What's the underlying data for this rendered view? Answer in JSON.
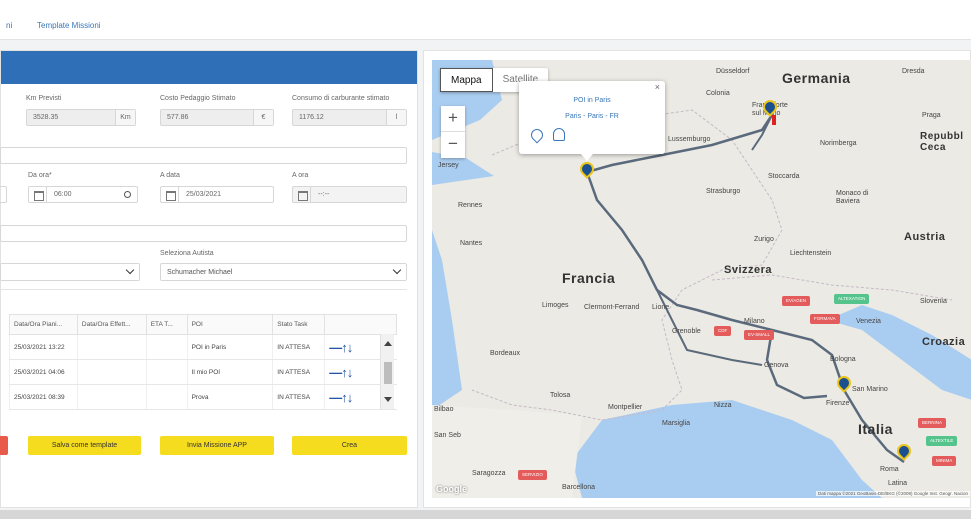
{
  "breadcrumb": {
    "prev": "ni",
    "current": "Template Missioni"
  },
  "form": {
    "km": {
      "label": "Km Previsti",
      "value": "3528.35",
      "unit": "Km"
    },
    "toll": {
      "label": "Costo Pedaggio Stimato",
      "value": "577.86",
      "unit": "€"
    },
    "fuel": {
      "label": "Consumo di carburante stimato",
      "value": "1176.12",
      "unit": "l"
    },
    "from_time": {
      "label": "Da ora*",
      "value": "06:00"
    },
    "to_date": {
      "label": "A data",
      "value": "25/03/2021"
    },
    "to_time": {
      "label": "A ora",
      "placeholder": "--:--"
    },
    "driver": {
      "label": "Seleziona Autista",
      "value": "Schumacher Michael"
    }
  },
  "table": {
    "headers": [
      "Data/Ora Piani...",
      "Data/Ora Effett...",
      "ETA T...",
      "POI",
      "Stato Task",
      ""
    ],
    "rows": [
      {
        "planned": "25/03/2021 13:22",
        "actual": "",
        "eta": "",
        "poi": "POI in Paris",
        "status": "IN ATTESA",
        "move": "—↑↓"
      },
      {
        "planned": "25/03/2021 04:06",
        "actual": "",
        "eta": "",
        "poi": "Il mio POI",
        "status": "IN ATTESA",
        "move": "—↑↓"
      },
      {
        "planned": "25/03/2021 08:39",
        "actual": "",
        "eta": "",
        "poi": "Prova",
        "status": "IN ATTESA",
        "move": "—↑↓"
      }
    ]
  },
  "buttons": {
    "save_template": "Salva come template",
    "send_app": "Invia Missione APP",
    "create": "Crea"
  },
  "map": {
    "type_map": "Mappa",
    "type_satellite": "Satellite",
    "zoom_in": "+",
    "zoom_out": "−",
    "popup_title": "POI in Paris",
    "popup_address": "Paris - Paris - FR",
    "close": "×",
    "countries": {
      "germany": "Germania",
      "france": "Francia",
      "switzerland": "Svizzera",
      "austria": "Austria",
      "italy": "Italia",
      "croatia": "Croazia",
      "czech": "Repubbl Ceca"
    },
    "cities": {
      "dusseldorf": "Düsseldorf",
      "dresda": "Dresda",
      "colonia": "Colonia",
      "praga": "Praga",
      "lussemburgo": "Lussemburgo",
      "norimberga": "Norimberga",
      "jersey": "Jersey",
      "stoccarda": "Stoccarda",
      "strasburgo": "Strasburgo",
      "monaco": "Monaco di Baviera",
      "rennes": "Rennes",
      "nantes": "Nantes",
      "zurigo": "Zurigo",
      "liechtenstein": "Liechtenstein",
      "limoges": "Limoges",
      "clermont": "Clermont-Ferrand",
      "lione": "Lione",
      "grenoble": "Grenoble",
      "milano": "Milano",
      "venezia": "Venezia",
      "slovenia": "Slovenia",
      "bologna": "Bologna",
      "genova": "Genova",
      "sanmarino": "San Marino",
      "firenze": "Firenze",
      "tolosa": "Tolosa",
      "montpellier": "Montpellier",
      "marsiglia": "Marsiglia",
      "nizza": "Nizza",
      "roma": "Roma",
      "saragozza": "Saragozza",
      "barcellona": "Barcellona",
      "bilbao": "Bilbao",
      "latina": "Latina",
      "francoforte": "Francoforte sul Meno",
      "bordeaux": "Bordeaux",
      "san_seb": "San Seb"
    },
    "tags": {
      "t1": "EV/AGEN",
      "t2": "ALTEXATION",
      "t3": "FORMAVA",
      "t4": "CDF",
      "t5": "EV-SMALL",
      "t6": "SERVIZIO",
      "t7": "ALTEXTILE",
      "t8": "BERNINA",
      "t9": "MINIMA"
    },
    "attribution": "Dati mappa ©2021 GeoBasis-DE/BKG (©2009) Google Inst. Geogr. Nacion",
    "logo": "Google",
    "colors": {
      "route": "#5a6a7c",
      "pin": "#1b4f8f",
      "pin_ring": "#e9c51b",
      "water": "#a9cdf0",
      "land": "#eceae4"
    }
  }
}
